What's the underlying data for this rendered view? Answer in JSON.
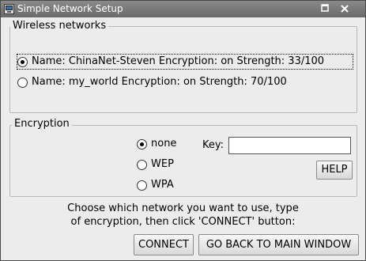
{
  "window": {
    "title": "Simple Network Setup",
    "icons": {
      "app": "network-icon",
      "restore": "restore-icon",
      "close": "close-icon"
    }
  },
  "wireless": {
    "label": "Wireless networks",
    "networks": [
      {
        "text": "Name: ChinaNet-Steven  Encryption: on  Strength: 33/100",
        "selected": true
      },
      {
        "text": "Name: my_world  Encryption: on  Strength: 70/100",
        "selected": false
      }
    ]
  },
  "encryption": {
    "label": "Encryption",
    "options": [
      {
        "label": "none",
        "selected": true
      },
      {
        "label": "WEP",
        "selected": false
      },
      {
        "label": "WPA",
        "selected": false
      }
    ],
    "key_label": "Key:",
    "key_value": "",
    "help_label": "HELP"
  },
  "instructions": {
    "line1": "Choose which network you want to use, type",
    "line2": "of encryption, then click 'CONNECT' button:"
  },
  "buttons": {
    "connect": "CONNECT",
    "back": "GO BACK TO MAIN WINDOW"
  }
}
